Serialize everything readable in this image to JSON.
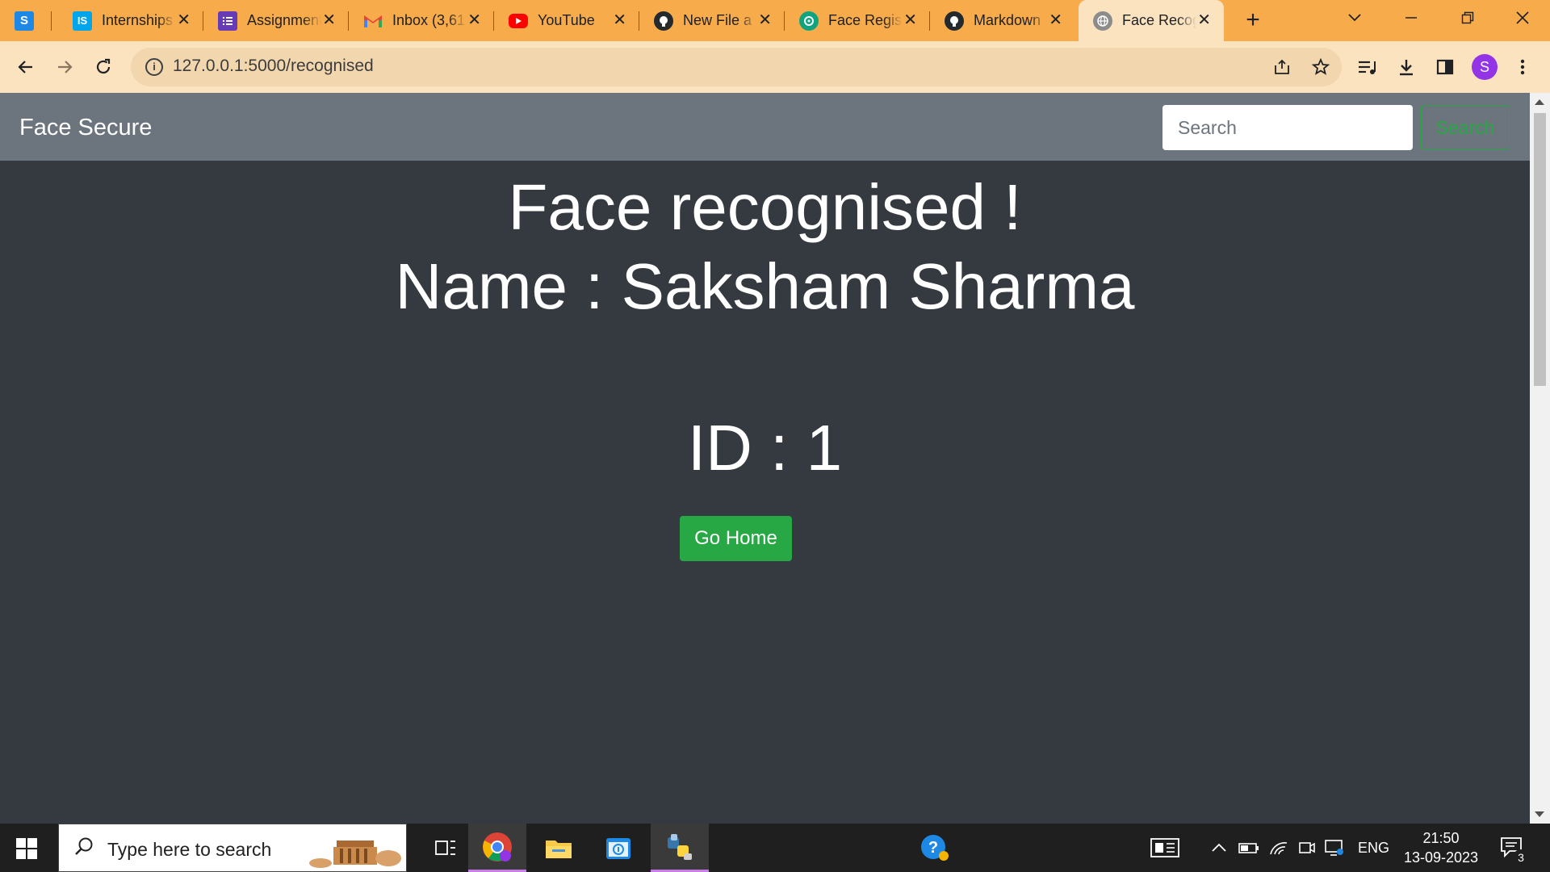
{
  "browser": {
    "tabs": [
      {
        "title": "",
        "favicon": "sololearn-icon",
        "color": "#1e88e5"
      },
      {
        "title": "Internships",
        "favicon": "internshala-icon",
        "color": "#00a5ec"
      },
      {
        "title": "Assignment",
        "favicon": "forms-icon",
        "color": "#673ab7"
      },
      {
        "title": "Inbox (3,61",
        "favicon": "gmail-icon",
        "color": "#ea4335"
      },
      {
        "title": "YouTube",
        "favicon": "youtube-icon",
        "color": "#ff0000"
      },
      {
        "title": "New File a",
        "favicon": "github-icon",
        "color": "#24292e"
      },
      {
        "title": "Face Regis",
        "favicon": "chatgpt-icon",
        "color": "#10a37f"
      },
      {
        "title": "Markdown",
        "favicon": "github-icon",
        "color": "#24292e"
      },
      {
        "title": "Face Recog",
        "favicon": "globe-icon",
        "color": "#8c8c8c"
      }
    ],
    "url": "127.0.0.1:5000/recognised",
    "profile_initial": "S"
  },
  "navbar": {
    "brand": "Face Secure",
    "search_placeholder": "Search",
    "search_button": "Search"
  },
  "main": {
    "headline": "Face recognised !",
    "name_line": "Name : Saksham Sharma",
    "id_line": "ID : 1",
    "go_home_label": "Go Home"
  },
  "taskbar": {
    "search_placeholder": "Type here to search",
    "language": "ENG",
    "time": "21:50",
    "date": "13-09-2023",
    "notification_count": "3"
  },
  "colors": {
    "tab_strip": "#f7ab4a",
    "toolbar": "#fbe3c0",
    "navbar": "#6c757d",
    "page_bg": "#343a40",
    "success": "#28a745"
  }
}
